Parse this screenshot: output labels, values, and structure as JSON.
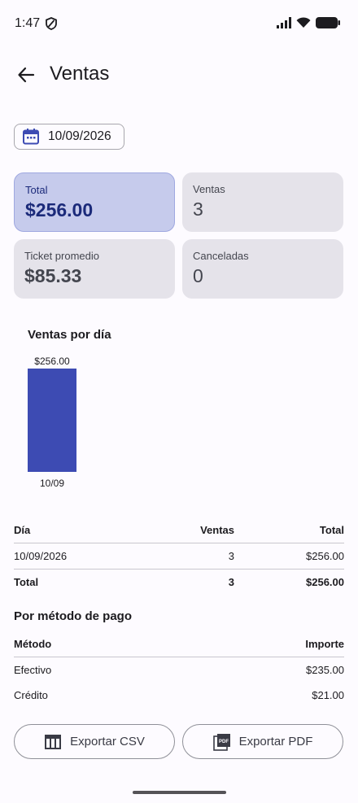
{
  "status": {
    "time": "1:47"
  },
  "appbar": {
    "title": "Ventas"
  },
  "date_filter": {
    "value": "10/09/2026"
  },
  "cards": [
    {
      "label": "Total",
      "value": "$256.00"
    },
    {
      "label": "Ventas",
      "value": "3"
    },
    {
      "label": "Ticket promedio",
      "value": "$85.33"
    },
    {
      "label": "Canceladas",
      "value": "0"
    }
  ],
  "chart_section_title": "Ventas por día",
  "chart_data": {
    "type": "bar",
    "categories": [
      "10/09"
    ],
    "values": [
      256.0
    ],
    "data_labels": [
      "$256.00"
    ],
    "color": "#3d4bb3"
  },
  "daily_table": {
    "headers": [
      "Día",
      "Ventas",
      "Total"
    ],
    "rows": [
      [
        "10/09/2026",
        "3",
        "$256.00"
      ]
    ],
    "totals": [
      "Total",
      "3",
      "$256.00"
    ]
  },
  "payment_section_title": "Por método de pago",
  "payment_table": {
    "headers": [
      "Método",
      "Importe"
    ],
    "rows": [
      [
        "Efectivo",
        "$235.00"
      ],
      [
        "Crédito",
        "$21.00"
      ]
    ]
  },
  "buttons": {
    "export_csv": "Exportar CSV",
    "export_pdf": "Exportar PDF"
  },
  "colors": {
    "accent": "#3d4bb3",
    "primary_card": "#c6cbec",
    "card": "#e5e3ea"
  }
}
